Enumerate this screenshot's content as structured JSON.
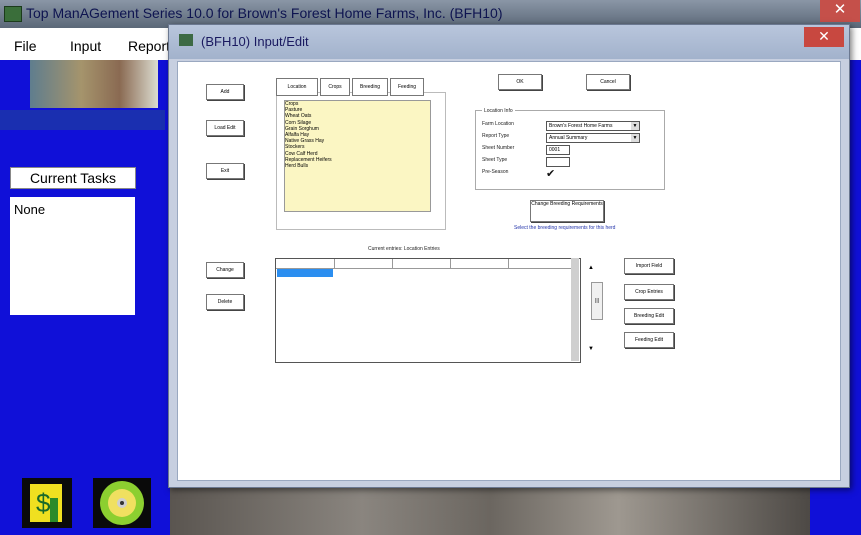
{
  "main_window": {
    "title": "Top ManAGement Series 10.0 for Brown's Forest Home Farms, Inc. (BFH10)",
    "close_glyph": "✕"
  },
  "menubar": {
    "items": [
      "File",
      "Input",
      "Report"
    ]
  },
  "left_panel": {
    "current_tasks_label": "Current Tasks",
    "tasks": [
      "None"
    ]
  },
  "dialog": {
    "title": "(BFH10) Input/Edit",
    "close_glyph": "✕",
    "left_buttons": [
      "Add",
      "Load Edit",
      "Exit"
    ],
    "lower_left_buttons": [
      "Change",
      "Delete"
    ],
    "tabs": [
      "Location",
      "Crops",
      "Breeding",
      "Feeding"
    ],
    "list_items": [
      "Crops",
      "Pasture",
      "Wheat Oats",
      "Corn Silage",
      "Grain Sorghum",
      "Alfalfa Hay",
      "Native Grass Hay",
      "Stockers",
      "Cow Calf Herd",
      "Replacement Heifers",
      "Herd Bulls"
    ],
    "top_buttons": [
      "OK",
      "Cancel"
    ],
    "group": {
      "title": "Location Info",
      "fields": [
        {
          "label": "Farm Location",
          "value": "Brown's Forest Home Farms",
          "kind": "combo"
        },
        {
          "label": "Report Type",
          "value": "Annual Summary",
          "kind": "combo"
        },
        {
          "label": "Sheet Number",
          "value": "0001",
          "kind": "text"
        },
        {
          "label": "Sheet Type",
          "value": "",
          "kind": "text"
        },
        {
          "label": "Pre-Season",
          "value": "",
          "kind": "check"
        }
      ],
      "check_glyph": "✔"
    },
    "change_breeding_button": "Change Breeding Requirements",
    "change_breeding_note": "Select the breeding requirements for this herd",
    "grid_caption": "Current entries: Location Entries",
    "right_buttons": [
      "Import Field",
      "Crop Entries",
      "Breeding Edit",
      "Feeding Edit"
    ],
    "scroll": {
      "up": "▲",
      "down": "▼",
      "thumb": "|||"
    }
  },
  "colors": {
    "desktop_blue": "#1010d8",
    "list_yellow": "#fbf6c3",
    "selection_blue": "#2b8ef0"
  }
}
